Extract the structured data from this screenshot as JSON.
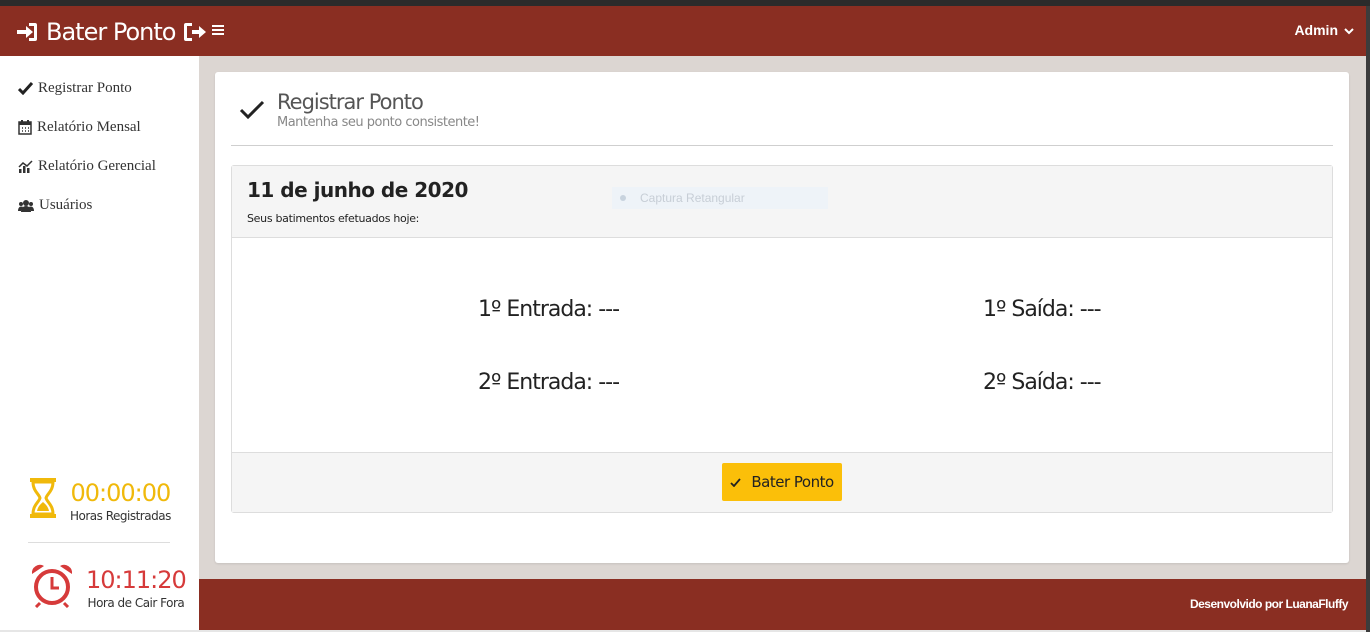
{
  "header": {
    "brand": "Bater Ponto",
    "user_menu": "Admin"
  },
  "sidebar": {
    "items": [
      {
        "label": "Registrar Ponto",
        "icon": "check-icon"
      },
      {
        "label": "Relatório Mensal",
        "icon": "calendar-icon"
      },
      {
        "label": "Relatório Gerencial",
        "icon": "chart-icon"
      },
      {
        "label": "Usuários",
        "icon": "users-icon"
      }
    ],
    "hours_registered": {
      "value": "00:00:00",
      "label": "Horas Registradas",
      "color": "#f0b90b"
    },
    "leave_time": {
      "value": "10:11:20",
      "label": "Hora de Cair Fora",
      "color": "#d63a3a"
    }
  },
  "page": {
    "title": "Registrar Ponto",
    "subtitle": "Mantenha seu ponto consistente!"
  },
  "panel": {
    "date": "11 de junho de 2020",
    "subtitle": "Seus batimentos efetuados hoje:",
    "overlay_text": "Captura Retangular",
    "entries": {
      "entrada1": "1º Entrada: ---",
      "saida1": "1º Saída: ---",
      "entrada2": "2º Entrada: ---",
      "saida2": "2º Saída: ---"
    },
    "button": "Bater Ponto"
  },
  "footer": {
    "credit": "Desenvolvido por LuanaFluffy"
  },
  "colors": {
    "brand": "#8a2e22",
    "button": "#fbbf09",
    "background": "#dcd6d2"
  }
}
